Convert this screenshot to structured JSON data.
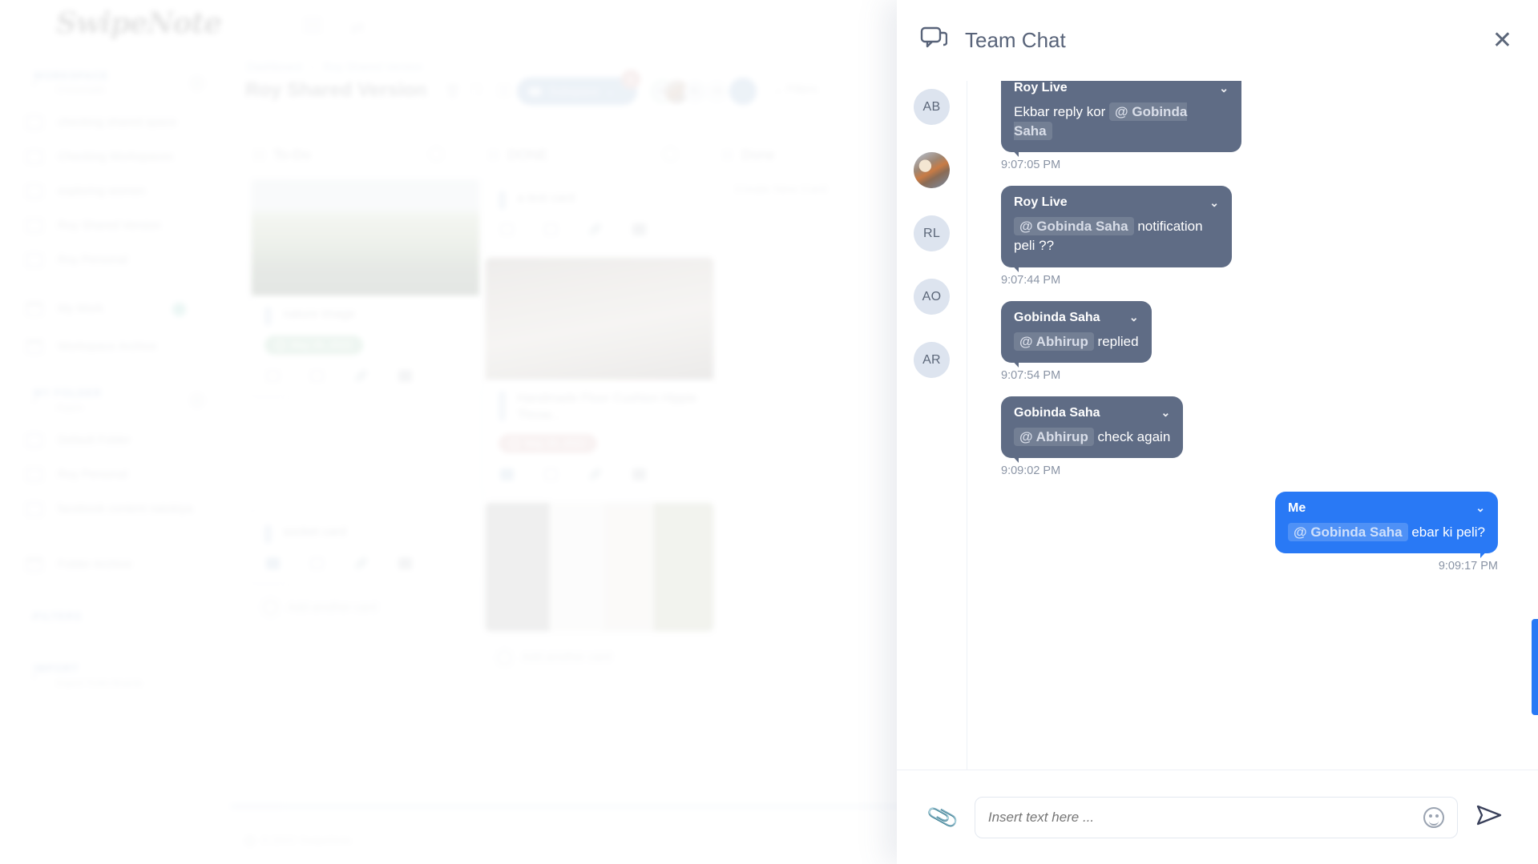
{
  "brand": {
    "logo": "SwipeNote",
    "copyright": "© 2022 SwipeNote."
  },
  "sidebar": {
    "sections": [
      {
        "title": "WORKSPACE",
        "subtitle": "Crossroads"
      },
      {
        "title": "MY FOLDER",
        "subtitle": "Aspen"
      },
      {
        "title": "FILTERS"
      },
      {
        "title": "IMPORT",
        "subtitle": "Import Trello Boards"
      }
    ],
    "workspace_items": [
      {
        "label": "checking shared space",
        "icon": "folder-icon",
        "more": "..."
      },
      {
        "label": "Checking Workspaces",
        "icon": "folder-icon",
        "more": "..."
      },
      {
        "label": "exploring women",
        "icon": "folder-icon",
        "more": "..."
      },
      {
        "label": "Roy Shared Version",
        "icon": "folder-icon",
        "more": "..."
      },
      {
        "label": "Roy Personal",
        "icon": "folder-icon",
        "more": "..."
      },
      {
        "label": "My Work",
        "icon": "calendar-icon",
        "badge": true
      },
      {
        "label": "Workspace Archive",
        "icon": "archive-icon"
      }
    ],
    "folder_items": [
      {
        "label": "Default Folder",
        "icon": "folder-icon"
      },
      {
        "label": "Roy Personal",
        "icon": "folder-icon",
        "more": "..."
      },
      {
        "label": "facebook content natokiya",
        "icon": "folder-icon",
        "more": "..."
      },
      {
        "label": "Folder Archive",
        "icon": "archive-icon"
      }
    ]
  },
  "topbar": {
    "menu_icon": "hamburger-menu-icon",
    "swap_icon": "swap-icon"
  },
  "page": {
    "breadcrumb": {
      "root": "Dashboard",
      "separator": "›",
      "current": "Roy Shared Version"
    },
    "title": "Roy Shared Version",
    "title_actions": [
      "pencil-icon",
      "trash-icon",
      "copy-icon",
      "archive-icon"
    ],
    "subspace_button": {
      "label": "Subspace",
      "badge": "1"
    },
    "avatars": [
      "AB",
      "photo",
      "RL",
      "+6"
    ],
    "filters_label": "Filters"
  },
  "board": {
    "columns": [
      {
        "name": "To-Do",
        "cards": [
          {
            "title": "nature image",
            "has_image": true,
            "image_kind": "nature-landscape",
            "date_chip": {
              "text": "May 26, 2022",
              "color": "#5fcf8e"
            }
          },
          {
            "title": "socket card",
            "has_image": false
          }
        ],
        "add_card_label": "Add another card"
      },
      {
        "name": "DONE",
        "cards": [
          {
            "title": "a test card",
            "has_image": false
          },
          {
            "title": "Handmade Floor Cushion Hippie Throw...",
            "has_image": true,
            "image_kind": "interior-photo",
            "date_chip": {
              "text": "May 20, 2022",
              "color": "#f5a0a0"
            }
          },
          {
            "title": "",
            "has_image": true,
            "image_kind": "product-grid"
          }
        ],
        "add_card_label": "Add another card"
      },
      {
        "name": "Done",
        "cards": [],
        "new_card_label": "Create New Card"
      }
    ]
  },
  "chat": {
    "title": "Team Chat",
    "chat_icon": "chat-bubble-icon",
    "close_icon": "close-icon",
    "participants": [
      {
        "initials": "AB",
        "type": "initials"
      },
      {
        "initials": "",
        "type": "photo"
      },
      {
        "initials": "RL",
        "type": "initials"
      },
      {
        "initials": "AO",
        "type": "initials"
      },
      {
        "initials": "AR",
        "type": "initials"
      }
    ],
    "messages": [
      {
        "author": "Roy Live",
        "side": "left",
        "segments": [
          {
            "type": "text",
            "value": "Ekbar reply kor "
          },
          {
            "type": "mention",
            "value": "@ Gobinda Saha"
          }
        ],
        "time": "9:07:05 PM"
      },
      {
        "author": "Roy Live",
        "side": "left",
        "segments": [
          {
            "type": "mention",
            "value": "@ Gobinda Saha"
          },
          {
            "type": "text",
            "value": " notification peli ??"
          }
        ],
        "time": "9:07:44 PM"
      },
      {
        "author": "Gobinda Saha",
        "side": "left",
        "segments": [
          {
            "type": "mention",
            "value": "@ Abhirup"
          },
          {
            "type": "text",
            "value": " replied"
          }
        ],
        "time": "9:07:54 PM"
      },
      {
        "author": "Gobinda Saha",
        "side": "left",
        "segments": [
          {
            "type": "mention",
            "value": "@ Abhirup"
          },
          {
            "type": "text",
            "value": " check again"
          }
        ],
        "time": "9:09:02 PM"
      },
      {
        "author": "Me",
        "side": "right",
        "segments": [
          {
            "type": "mention",
            "value": "@ Gobinda Saha"
          },
          {
            "type": "text",
            "value": " ebar ki peli?"
          }
        ],
        "time": "9:09:17 PM"
      }
    ],
    "composer": {
      "attach_icon": "paperclip-icon",
      "placeholder": "Insert text here ...",
      "value": "",
      "emoji_icon": "smiley-icon",
      "send_icon": "send-icon"
    },
    "dropdown_icon": "chevron-down-icon",
    "colors": {
      "bubble_other": "#5f6c85",
      "bubble_me": "#2979f5",
      "header_text": "#586379"
    }
  }
}
